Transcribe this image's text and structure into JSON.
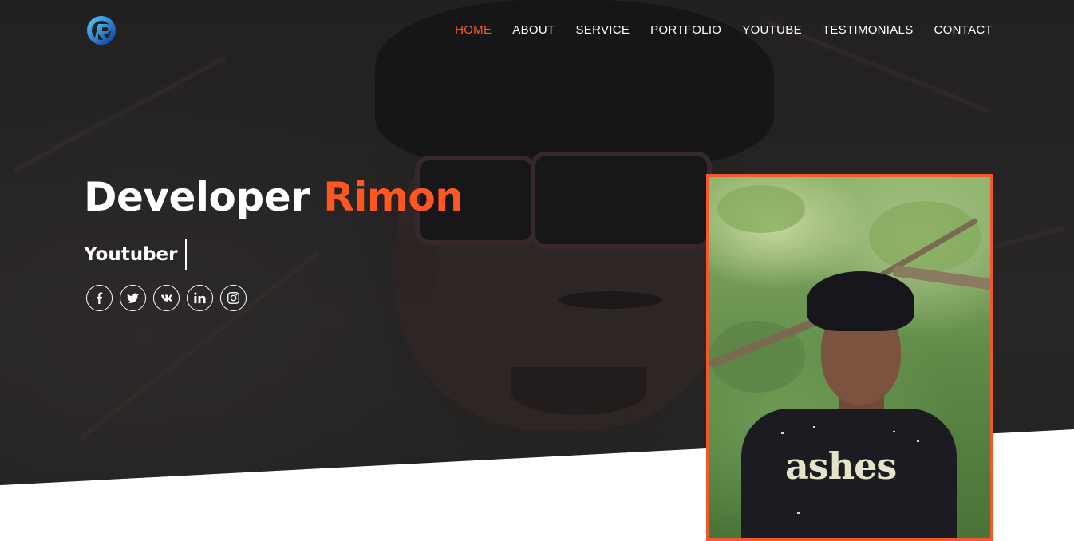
{
  "nav": {
    "items": [
      {
        "label": "HOME",
        "active": true
      },
      {
        "label": "ABOUT",
        "active": false
      },
      {
        "label": "SERVICE",
        "active": false
      },
      {
        "label": "PORTFOLIO",
        "active": false
      },
      {
        "label": "YOUTUBE",
        "active": false
      },
      {
        "label": "TESTIMONIALS",
        "active": false
      },
      {
        "label": "CONTACT",
        "active": false
      }
    ]
  },
  "hero": {
    "title_first": "Developer",
    "title_accent": "Rimon",
    "subtitle": "Youtuber"
  },
  "social": [
    {
      "icon": "facebook-icon"
    },
    {
      "icon": "twitter-icon"
    },
    {
      "icon": "vk-icon"
    },
    {
      "icon": "linkedin-icon"
    },
    {
      "icon": "instagram-icon"
    }
  ],
  "profile_photo": {
    "shirt_text": "ashes"
  },
  "colors": {
    "accent": "#ff5722",
    "frame": "#ee5a2b",
    "text": "#ffffff",
    "logo": "#1e88e5"
  }
}
